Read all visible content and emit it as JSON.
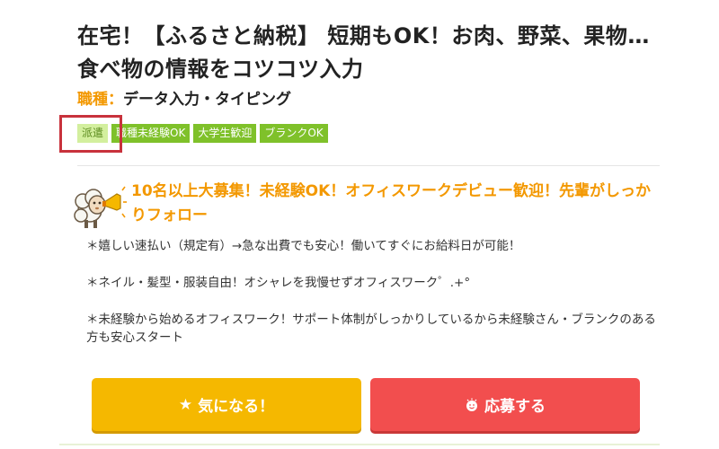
{
  "job": {
    "title": "在宅！【ふるさと納税】 短期もOK！お肉、野菜、果物…食べ物の情報をコツコツ入力",
    "type_label": "職種：",
    "type_value": "データ入力・タイピング"
  },
  "tags": [
    "派遣",
    "職種未経験OK",
    "大学生歓迎",
    "ブランクOK"
  ],
  "headline": "10名以上大募集！未経験OK！オフィスワークデビュー歓迎！先輩がしっかりフォロー",
  "body": [
    "＊嬉しい速払い（規定有）→急な出費でも安心！働いてすぐにお給料日が可能！",
    "＊ネイル・髪型・服装自由！オシャレを我慢せずオフィスワーク゜.+°",
    "＊未経験から始めるオフィスワーク！サポート体制がしっかりしているから未経験さん・ブランクのある方も安心スタート"
  ],
  "buttons": {
    "favorite": "気になる！",
    "apply": "応募する"
  },
  "icons": {
    "favorite": "star-icon",
    "apply": "smiley-icon",
    "mascot": "sheep-megaphone-icon"
  },
  "colors": {
    "accent_orange": "#f39800",
    "tag_green": "#7fc12a",
    "favorite_yellow": "#f5b800",
    "apply_red": "#f24e4e",
    "highlight_red": "#c8323c"
  }
}
